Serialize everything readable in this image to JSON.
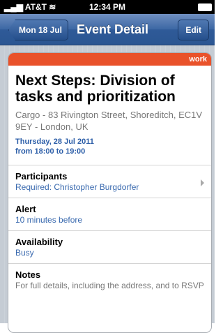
{
  "status": {
    "carrier": "AT&T",
    "time": "12:34 PM"
  },
  "nav": {
    "back": "Mon 18 Jul",
    "title": "Event Detail",
    "edit": "Edit"
  },
  "event": {
    "tag": "work",
    "title": "Next Steps: Division of tasks and prioritization",
    "location": "Cargo - 83 Rivington Street, Shoreditch, EC1V 9EY - London, UK",
    "date_line1": "Thursday, 28 Jul 2011",
    "date_line2": "from 18:00 to 19:00"
  },
  "rows": {
    "participants": {
      "label": "Participants",
      "value": "Required: Christopher Burgdorfer"
    },
    "alert": {
      "label": "Alert",
      "value": "10 minutes before"
    },
    "availability": {
      "label": "Availability",
      "value": "Busy"
    },
    "notes": {
      "label": "Notes",
      "value": "For full details, including the address, and to RSVP"
    }
  },
  "colors": {
    "accent": "#e9522a",
    "link": "#3a6aaf",
    "navbar": "#3c67a4"
  }
}
